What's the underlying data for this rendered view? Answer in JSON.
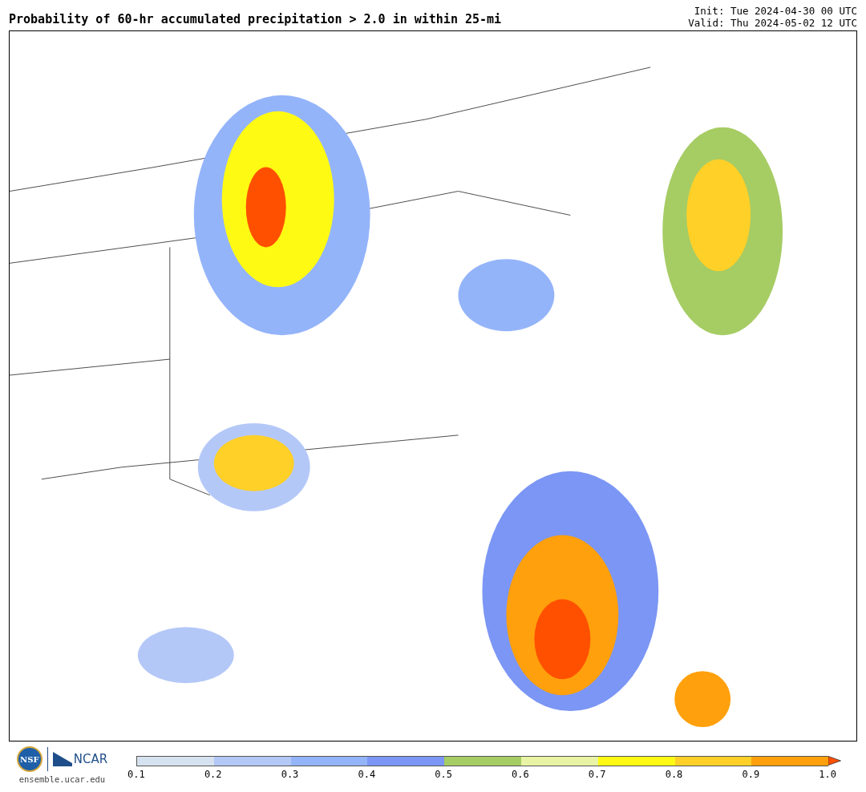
{
  "title": "Probability of 60-hr accumulated precipitation > 2.0 in within 25-mi",
  "init": "Init: Tue 2024-04-30 00 UTC",
  "valid": "Valid: Thu 2024-05-02 12 UTC",
  "logos": {
    "nsf": "NSF",
    "ncar": "NCAR",
    "url": "ensemble.ucar.edu"
  },
  "colorbar": {
    "segments": [
      {
        "color": "#d6e2ef"
      },
      {
        "color": "#b4c8f8"
      },
      {
        "color": "#94b4fa"
      },
      {
        "color": "#7b96f4"
      },
      {
        "color": "#a6cc64"
      },
      {
        "color": "#e8f4a4"
      },
      {
        "color": "#fffa14"
      },
      {
        "color": "#ffd028"
      },
      {
        "color": "#ffa00c"
      },
      {
        "kind": "extend",
        "color": "#ff5000"
      }
    ],
    "ticks": [
      "0.1",
      "0.2",
      "0.3",
      "0.4",
      "0.5",
      "0.6",
      "0.7",
      "0.8",
      "0.9",
      "1.0"
    ]
  }
}
